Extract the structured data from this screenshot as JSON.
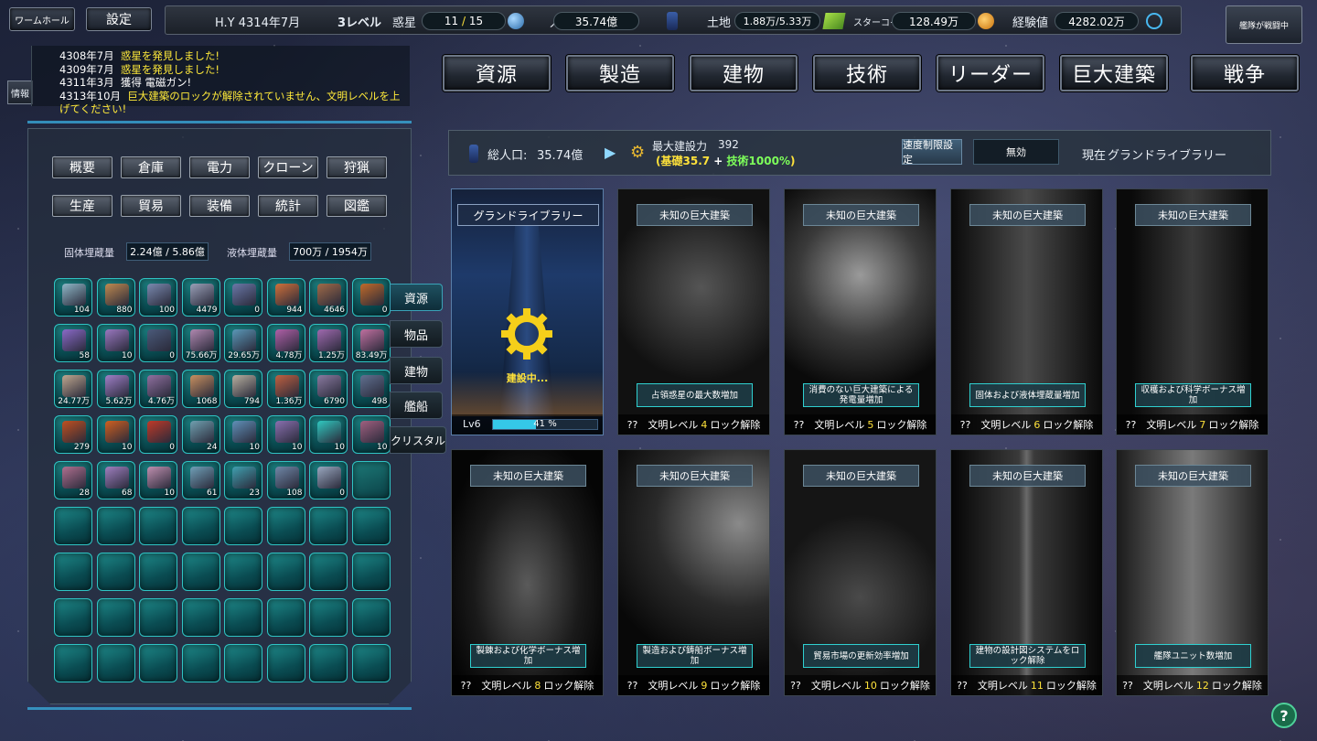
{
  "top": {
    "wormhole_btn": "ワームホール",
    "settings_btn": "設定",
    "era": "H.Y 4314年7月",
    "level": "3レベル",
    "planet_label": "惑星",
    "planet_current": "11",
    "planet_sep": " / ",
    "planet_total": "15",
    "population_label": "人口",
    "population_value": "35.74億",
    "land_label": "土地",
    "land_value": "1.88万/5.33万",
    "starcoin_label": "スターコイン",
    "starcoin_value": "128.49万",
    "exp_label": "経験値",
    "exp_value": "4282.02万",
    "fleet_status": "艦隊が戦闘中"
  },
  "log": {
    "info_tab": "情報",
    "entries": [
      {
        "date": "4308年7月",
        "msg": "惑星を発見しました!"
      },
      {
        "date": "4309年7月",
        "msg": "惑星を発見しました!"
      },
      {
        "date": "4311年3月",
        "msg": "獲得 電磁ガン!"
      },
      {
        "date": "4313年10月",
        "msg": "巨大建築のロックが解除されていません、文明レベルを上げてください!"
      }
    ]
  },
  "nav": [
    "資源",
    "製造",
    "建物",
    "技術",
    "リーダー",
    "巨大建築",
    "戦争"
  ],
  "categories_row1": [
    "概要",
    "倉庫",
    "電力",
    "クローン",
    "狩猟"
  ],
  "categories_row2": [
    "生産",
    "貿易",
    "装備",
    "統計",
    "図鑑"
  ],
  "storage": {
    "solid_label": "固体埋蔵量",
    "solid_value": "2.24億 / 5.86億",
    "liquid_label": "液体埋蔵量",
    "liquid_value": "700万 / 1954万"
  },
  "side_tabs": [
    "資源",
    "物品",
    "建物",
    "艦船",
    "クリスタル"
  ],
  "inventory": [
    [
      "104",
      "880",
      "100",
      "4479",
      "0",
      "944",
      "4646",
      "0"
    ],
    [
      "58",
      "10",
      "0",
      "75.66万",
      "29.65万",
      "4.78万",
      "1.25万",
      "83.49万"
    ],
    [
      "24.77万",
      "5.62万",
      "4.76万",
      "1068",
      "794",
      "1.36万",
      "6790",
      "498"
    ],
    [
      "279",
      "10",
      "0",
      "24",
      "10",
      "10",
      "10",
      "10"
    ],
    [
      "28",
      "68",
      "10",
      "61",
      "23",
      "108",
      "0",
      ""
    ]
  ],
  "item_colors": [
    [
      "#8fb8c8",
      "#c08a50",
      "#7a8ab0",
      "#9aa0b8",
      "#6a78a8",
      "#d0703a",
      "#a06a48",
      "#c06a2a"
    ],
    [
      "#8a6ac8",
      "#9a78c0",
      "#4a5a7a",
      "#b088b0",
      "#5a98b8",
      "#b060a8",
      "#a06ab0",
      "#c070a0"
    ],
    [
      "#c0a890",
      "#a080c8",
      "#9070a0",
      "#c89060",
      "#b8b0a0",
      "#c06040",
      "#8a7aa0",
      "#607090"
    ],
    [
      "#c05020",
      "#d06020",
      "#c03a28",
      "#70a0b0",
      "#6090b8",
      "#8a70b0",
      "#30c8c0",
      "#a06080"
    ],
    [
      "#b07090",
      "#a080c0",
      "#c090b0",
      "#70a0b8",
      "#40a0b0",
      "#7088a8",
      "#9aa8c0",
      ""
    ]
  ],
  "info": {
    "total_pop_label": "総人口:",
    "total_pop_value": "35.74億",
    "max_build_label": "最大建設力",
    "max_build_value": "392",
    "open_paren": "(",
    "base_label": "基礎",
    "base_value": "35.7",
    "plus": " + ",
    "tech_label": "技術",
    "tech_value": "1000%",
    "close_paren": ")",
    "speed_limit_label": "速度制限設定",
    "speed_limit_value": "無効",
    "current_label": "現在",
    "current_value": "グランドライブラリー"
  },
  "grand_library": {
    "title": "グランドライブラリー",
    "status": "建設中...",
    "level": "Lv6",
    "progress_label": "41 %",
    "progress": 0.41
  },
  "cards": [
    {
      "title": "未知の巨大建築",
      "bonus": "占領惑星の最大数増加",
      "lock_pre": "??　文明レベル",
      "lock_level": "4",
      "lock_post": "ロック解除"
    },
    {
      "title": "未知の巨大建築",
      "bonus": "消費のない巨大建築による発電量増加",
      "lock_pre": "??　文明レベル",
      "lock_level": "5",
      "lock_post": "ロック解除"
    },
    {
      "title": "未知の巨大建築",
      "bonus": "固体および液体埋蔵量増加",
      "lock_pre": "??　文明レベル",
      "lock_level": "6",
      "lock_post": "ロック解除"
    },
    {
      "title": "未知の巨大建築",
      "bonus": "収穫および科学ボーナス増加",
      "lock_pre": "??　文明レベル",
      "lock_level": "7",
      "lock_post": "ロック解除"
    },
    {
      "title": "未知の巨大建築",
      "bonus": "製錬および化学ボーナス増加",
      "lock_pre": "??　文明レベル",
      "lock_level": "8",
      "lock_post": "ロック解除"
    },
    {
      "title": "未知の巨大建築",
      "bonus": "製造および鋳船ボーナス増加",
      "lock_pre": "??　文明レベル",
      "lock_level": "9",
      "lock_post": "ロック解除"
    },
    {
      "title": "未知の巨大建築",
      "bonus": "貿易市場の更新効率増加",
      "lock_pre": "??　文明レベル",
      "lock_level": "10",
      "lock_post": "ロック解除"
    },
    {
      "title": "未知の巨大建築",
      "bonus": "建物の設計図システムをロック解除",
      "lock_pre": "??　文明レベル",
      "lock_level": "11",
      "lock_post": "ロック解除"
    },
    {
      "title": "未知の巨大建築",
      "bonus": "艦隊ユニット数増加",
      "lock_pre": "??　文明レベル",
      "lock_level": "12",
      "lock_post": "ロック解除"
    }
  ],
  "help": "?",
  "colors": {
    "accent_yellow": "#ffe23a",
    "accent_cyan": "#2fd0d0",
    "progress_fill": "#35c8e8",
    "bonus_green": "#7dff5a"
  }
}
